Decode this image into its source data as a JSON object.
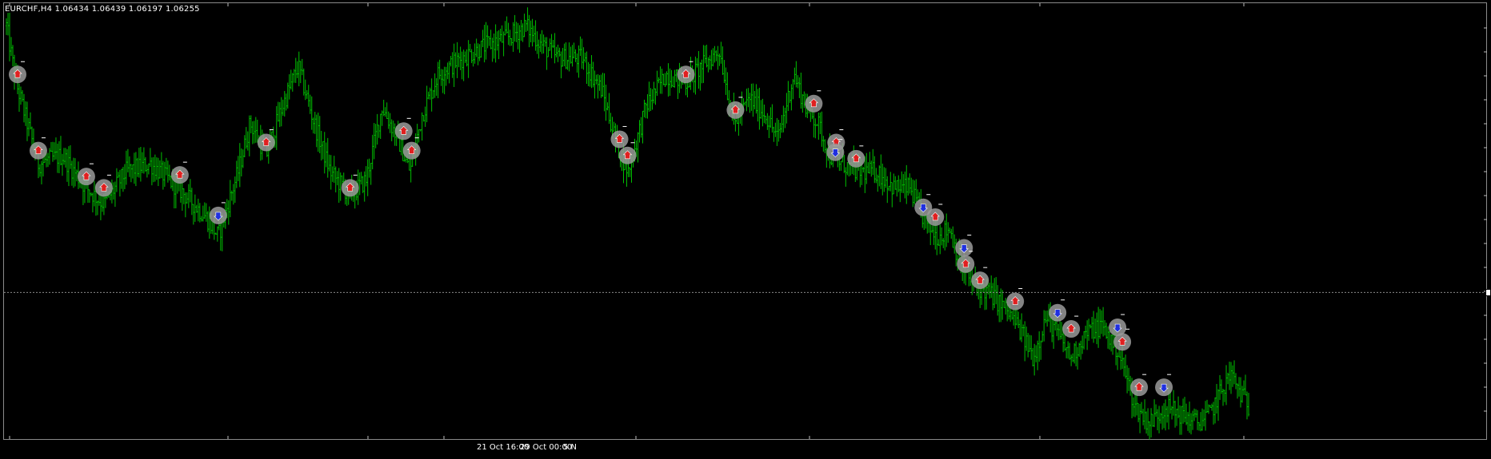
{
  "window": {
    "title": "EURCHF,H4  1.06434 1.06439 1.06197 1.06255"
  },
  "colors": {
    "background": "#000000",
    "bar": "#00c000",
    "frame": "#8a8a8a",
    "current_price_line": "#8a8a8a",
    "marker_fill": "#9a9a9a",
    "arrow_red": "#e02020",
    "arrow_blue": "#2030e0",
    "text": "#ffffff"
  },
  "x_axis": {
    "labels": [
      "21 Oct 16:00",
      "29 Oct 00:00",
      "5 N"
    ]
  },
  "chart_data": {
    "type": "ohlc",
    "symbol": "EURCHF",
    "timeframe": "H4",
    "last_bar": {
      "open": 1.06434,
      "high": 1.06439,
      "low": 1.06197,
      "close": 1.06255
    },
    "x_tick_labels": [
      "21 Oct 16:00",
      "29 Oct 00:00",
      "5 N"
    ],
    "grid": false,
    "price_scale": {
      "min": 1.054,
      "max": 1.08
    },
    "current_price": 1.06255,
    "close_path": [
      [
        0,
        1.079
      ],
      [
        12,
        1.0755
      ],
      [
        40,
        1.0705
      ],
      [
        70,
        1.071
      ],
      [
        100,
        1.069
      ],
      [
        122,
        1.068
      ],
      [
        150,
        1.07
      ],
      [
        180,
        1.0705
      ],
      [
        215,
        1.069
      ],
      [
        250,
        1.0672
      ],
      [
        265,
        1.066
      ],
      [
        290,
        1.07
      ],
      [
        305,
        1.073
      ],
      [
        325,
        1.071
      ],
      [
        345,
        1.074
      ],
      [
        365,
        1.0765
      ],
      [
        385,
        1.073
      ],
      [
        405,
        1.07
      ],
      [
        430,
        1.0685
      ],
      [
        450,
        1.0695
      ],
      [
        470,
        1.074
      ],
      [
        490,
        1.072
      ],
      [
        505,
        1.07
      ],
      [
        520,
        1.0735
      ],
      [
        540,
        1.076
      ],
      [
        570,
        1.077
      ],
      [
        600,
        1.0778
      ],
      [
        625,
        1.0782
      ],
      [
        650,
        1.079
      ],
      [
        670,
        1.0778
      ],
      [
        690,
        1.077
      ],
      [
        720,
        1.077
      ],
      [
        745,
        1.075
      ],
      [
        765,
        1.0715
      ],
      [
        778,
        1.07
      ],
      [
        800,
        1.074
      ],
      [
        825,
        1.076
      ],
      [
        850,
        1.0755
      ],
      [
        870,
        1.0765
      ],
      [
        892,
        1.0775
      ],
      [
        910,
        1.073
      ],
      [
        930,
        1.0745
      ],
      [
        950,
        1.0735
      ],
      [
        965,
        1.072
      ],
      [
        985,
        1.076
      ],
      [
        1000,
        1.074
      ],
      [
        1015,
        1.073
      ],
      [
        1030,
        1.071
      ],
      [
        1045,
        1.0705
      ],
      [
        1065,
        1.07
      ],
      [
        1090,
        1.07
      ],
      [
        1110,
        1.069
      ],
      [
        1130,
        1.069
      ],
      [
        1150,
        1.0668
      ],
      [
        1165,
        1.066
      ],
      [
        1180,
        1.0665
      ],
      [
        1195,
        1.064
      ],
      [
        1210,
        1.063
      ],
      [
        1230,
        1.0625
      ],
      [
        1250,
        1.0615
      ],
      [
        1265,
        1.0605
      ],
      [
        1285,
        1.0585
      ],
      [
        1300,
        1.061
      ],
      [
        1315,
        1.06
      ],
      [
        1332,
        1.0585
      ],
      [
        1350,
        1.06
      ],
      [
        1370,
        1.0605
      ],
      [
        1390,
        1.059
      ],
      [
        1400,
        1.0575
      ],
      [
        1412,
        1.0555
      ],
      [
        1430,
        1.0545
      ],
      [
        1450,
        1.0555
      ],
      [
        1470,
        1.055
      ],
      [
        1490,
        1.0545
      ],
      [
        1505,
        1.055
      ],
      [
        1520,
        1.0565
      ],
      [
        1532,
        1.0575
      ],
      [
        1542,
        1.0565
      ],
      [
        1555,
        1.0555
      ]
    ],
    "signals": [
      {
        "i": 14,
        "p": 1.076,
        "dir": "up"
      },
      {
        "i": 40,
        "p": 1.0713,
        "dir": "up"
      },
      {
        "i": 100,
        "p": 1.0697,
        "dir": "up"
      },
      {
        "i": 122,
        "p": 1.069,
        "dir": "up"
      },
      {
        "i": 217,
        "p": 1.0698,
        "dir": "up"
      },
      {
        "i": 265,
        "p": 1.0673,
        "dir": "down"
      },
      {
        "i": 325,
        "p": 1.0718,
        "dir": "up"
      },
      {
        "i": 430,
        "p": 1.069,
        "dir": "up"
      },
      {
        "i": 497,
        "p": 1.0725,
        "dir": "up"
      },
      {
        "i": 507,
        "p": 1.0713,
        "dir": "up"
      },
      {
        "i": 767,
        "p": 1.072,
        "dir": "up"
      },
      {
        "i": 777,
        "p": 1.071,
        "dir": "up"
      },
      {
        "i": 850,
        "p": 1.076,
        "dir": "up"
      },
      {
        "i": 912,
        "p": 1.0738,
        "dir": "up"
      },
      {
        "i": 1010,
        "p": 1.0742,
        "dir": "up"
      },
      {
        "i": 1038,
        "p": 1.0718,
        "dir": "up"
      },
      {
        "i": 1037,
        "p": 1.0712,
        "dir": "down"
      },
      {
        "i": 1063,
        "p": 1.0708,
        "dir": "up"
      },
      {
        "i": 1147,
        "p": 1.0678,
        "dir": "down"
      },
      {
        "i": 1162,
        "p": 1.0672,
        "dir": "up"
      },
      {
        "i": 1198,
        "p": 1.0653,
        "dir": "down"
      },
      {
        "i": 1200,
        "p": 1.0643,
        "dir": "up"
      },
      {
        "i": 1218,
        "p": 1.0633,
        "dir": "up"
      },
      {
        "i": 1262,
        "p": 1.062,
        "dir": "up"
      },
      {
        "i": 1315,
        "p": 1.0613,
        "dir": "down"
      },
      {
        "i": 1332,
        "p": 1.0603,
        "dir": "up"
      },
      {
        "i": 1390,
        "p": 1.0604,
        "dir": "down"
      },
      {
        "i": 1396,
        "p": 1.0595,
        "dir": "up"
      },
      {
        "i": 1417,
        "p": 1.0567,
        "dir": "up"
      },
      {
        "i": 1448,
        "p": 1.0567,
        "dir": "down"
      }
    ]
  }
}
